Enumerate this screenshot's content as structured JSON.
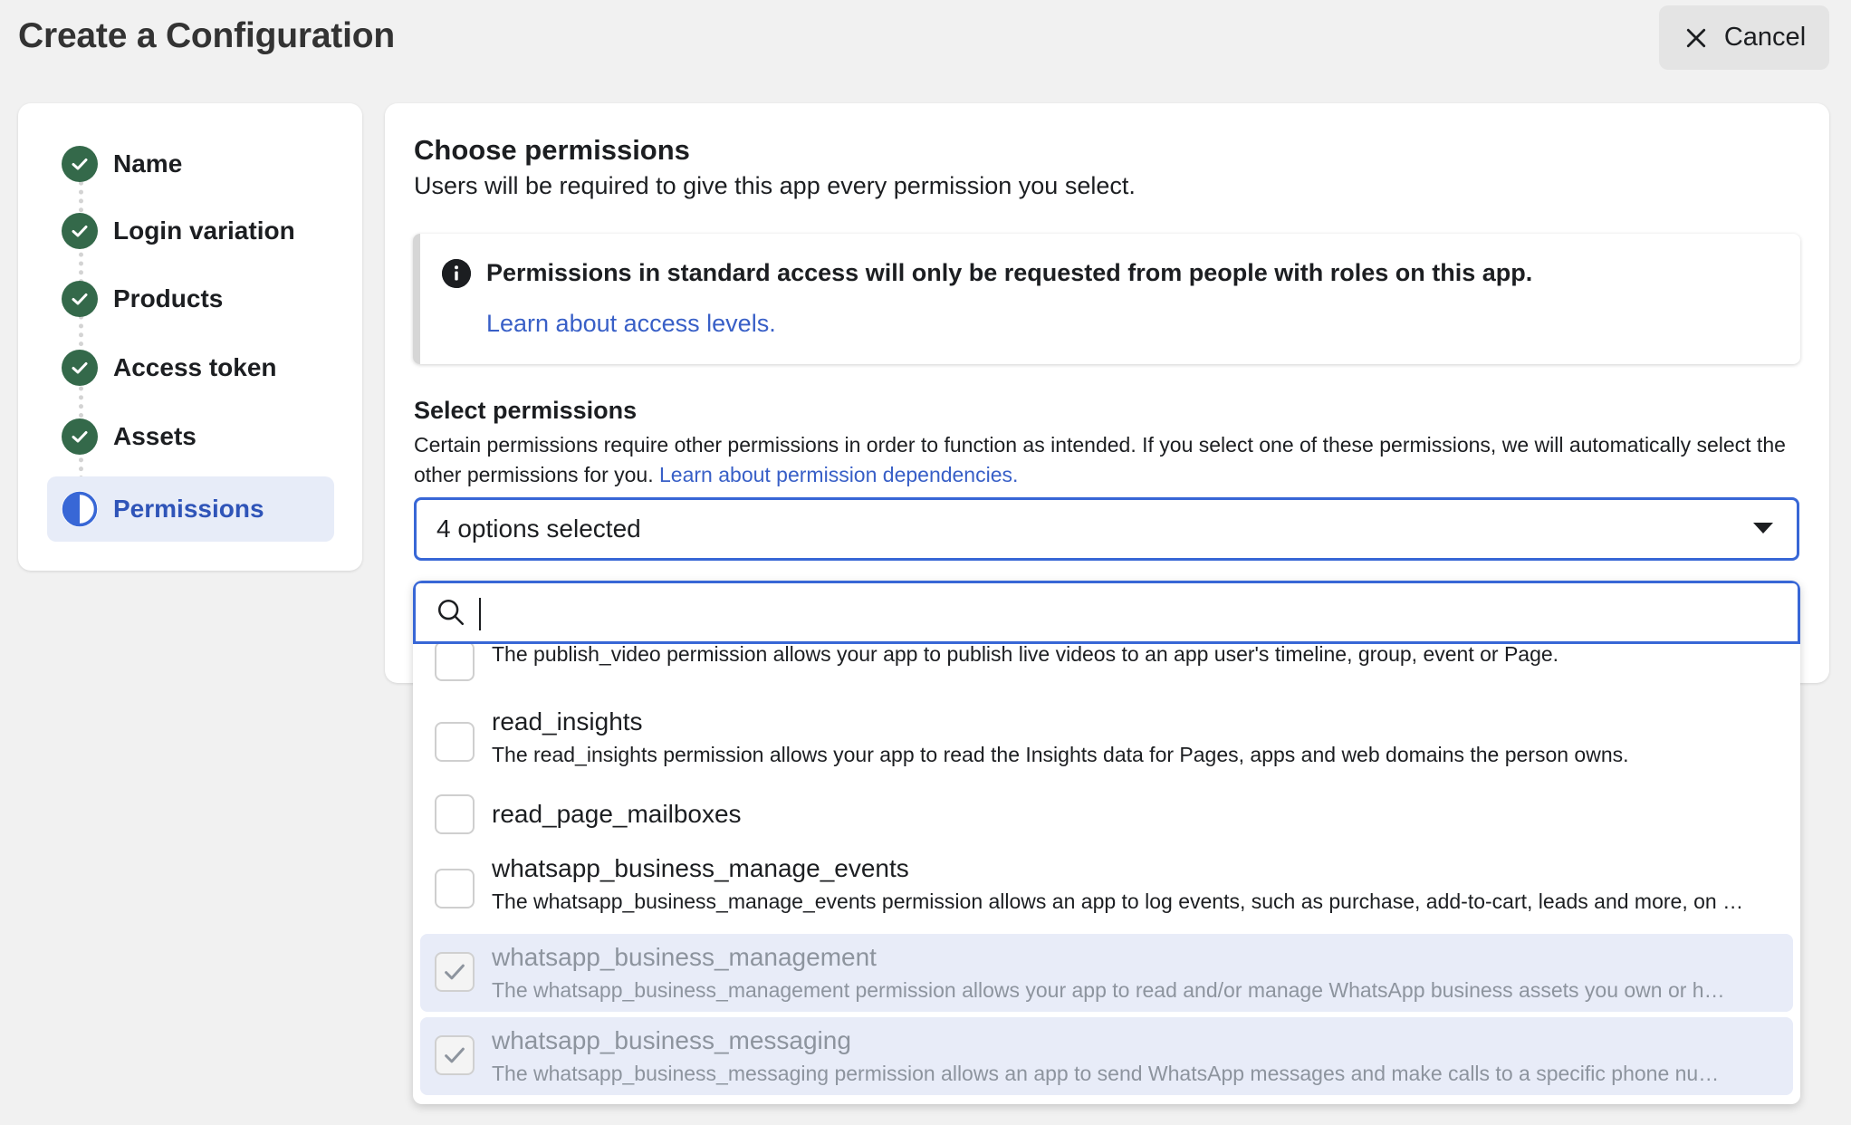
{
  "header": {
    "title": "Create a Configuration",
    "cancel_label": "Cancel"
  },
  "stepper": {
    "steps": [
      {
        "label": "Name",
        "state": "complete"
      },
      {
        "label": "Login variation",
        "state": "complete"
      },
      {
        "label": "Products",
        "state": "complete"
      },
      {
        "label": "Access token",
        "state": "complete"
      },
      {
        "label": "Assets",
        "state": "complete"
      },
      {
        "label": "Permissions",
        "state": "in-progress"
      }
    ]
  },
  "main": {
    "title": "Choose permissions",
    "subtitle": "Users will be required to give this app every permission you select.",
    "notice": {
      "text": "Permissions in standard access will only be requested from people with roles on this app.",
      "link": "Learn about access levels."
    },
    "select": {
      "title": "Select permissions",
      "description": "Certain permissions require other permissions in order to function as intended. If you select one of these permissions, we will automatically select the other permissions for you.",
      "description_link": "Learn about permission dependencies.",
      "value": "4 options selected"
    },
    "search": {
      "value": "",
      "placeholder": ""
    },
    "options": [
      {
        "name": "publish_video",
        "description": "The publish_video permission allows your app to publish live videos to an app user's timeline, group, event or Page.",
        "checked": false
      },
      {
        "name": "read_insights",
        "description": "The read_insights permission allows your app to read the Insights data for Pages, apps and web domains the person owns.",
        "checked": false
      },
      {
        "name": "read_page_mailboxes",
        "description": "",
        "checked": false
      },
      {
        "name": "whatsapp_business_manage_events",
        "description": "The whatsapp_business_manage_events permission allows an app to log events, such as purchase, add-to-cart, leads and more, on …",
        "checked": false
      },
      {
        "name": "whatsapp_business_management",
        "description": "The whatsapp_business_management permission allows your app to read and/or manage WhatsApp business assets you own or h…",
        "checked": true
      },
      {
        "name": "whatsapp_business_messaging",
        "description": "The whatsapp_business_messaging permission allows an app to send WhatsApp messages and make calls to a specific phone nu…",
        "checked": true
      }
    ]
  },
  "colors": {
    "accent": "#3867d6",
    "link": "#385fc7",
    "complete": "#34694a",
    "active_bg": "#e7ecf8",
    "checked_bg": "#e8ecf8"
  },
  "icons": {
    "cancel": "close-icon",
    "info": "info-icon",
    "search": "search-icon",
    "check": "check-icon",
    "caret": "caret-down-icon"
  }
}
